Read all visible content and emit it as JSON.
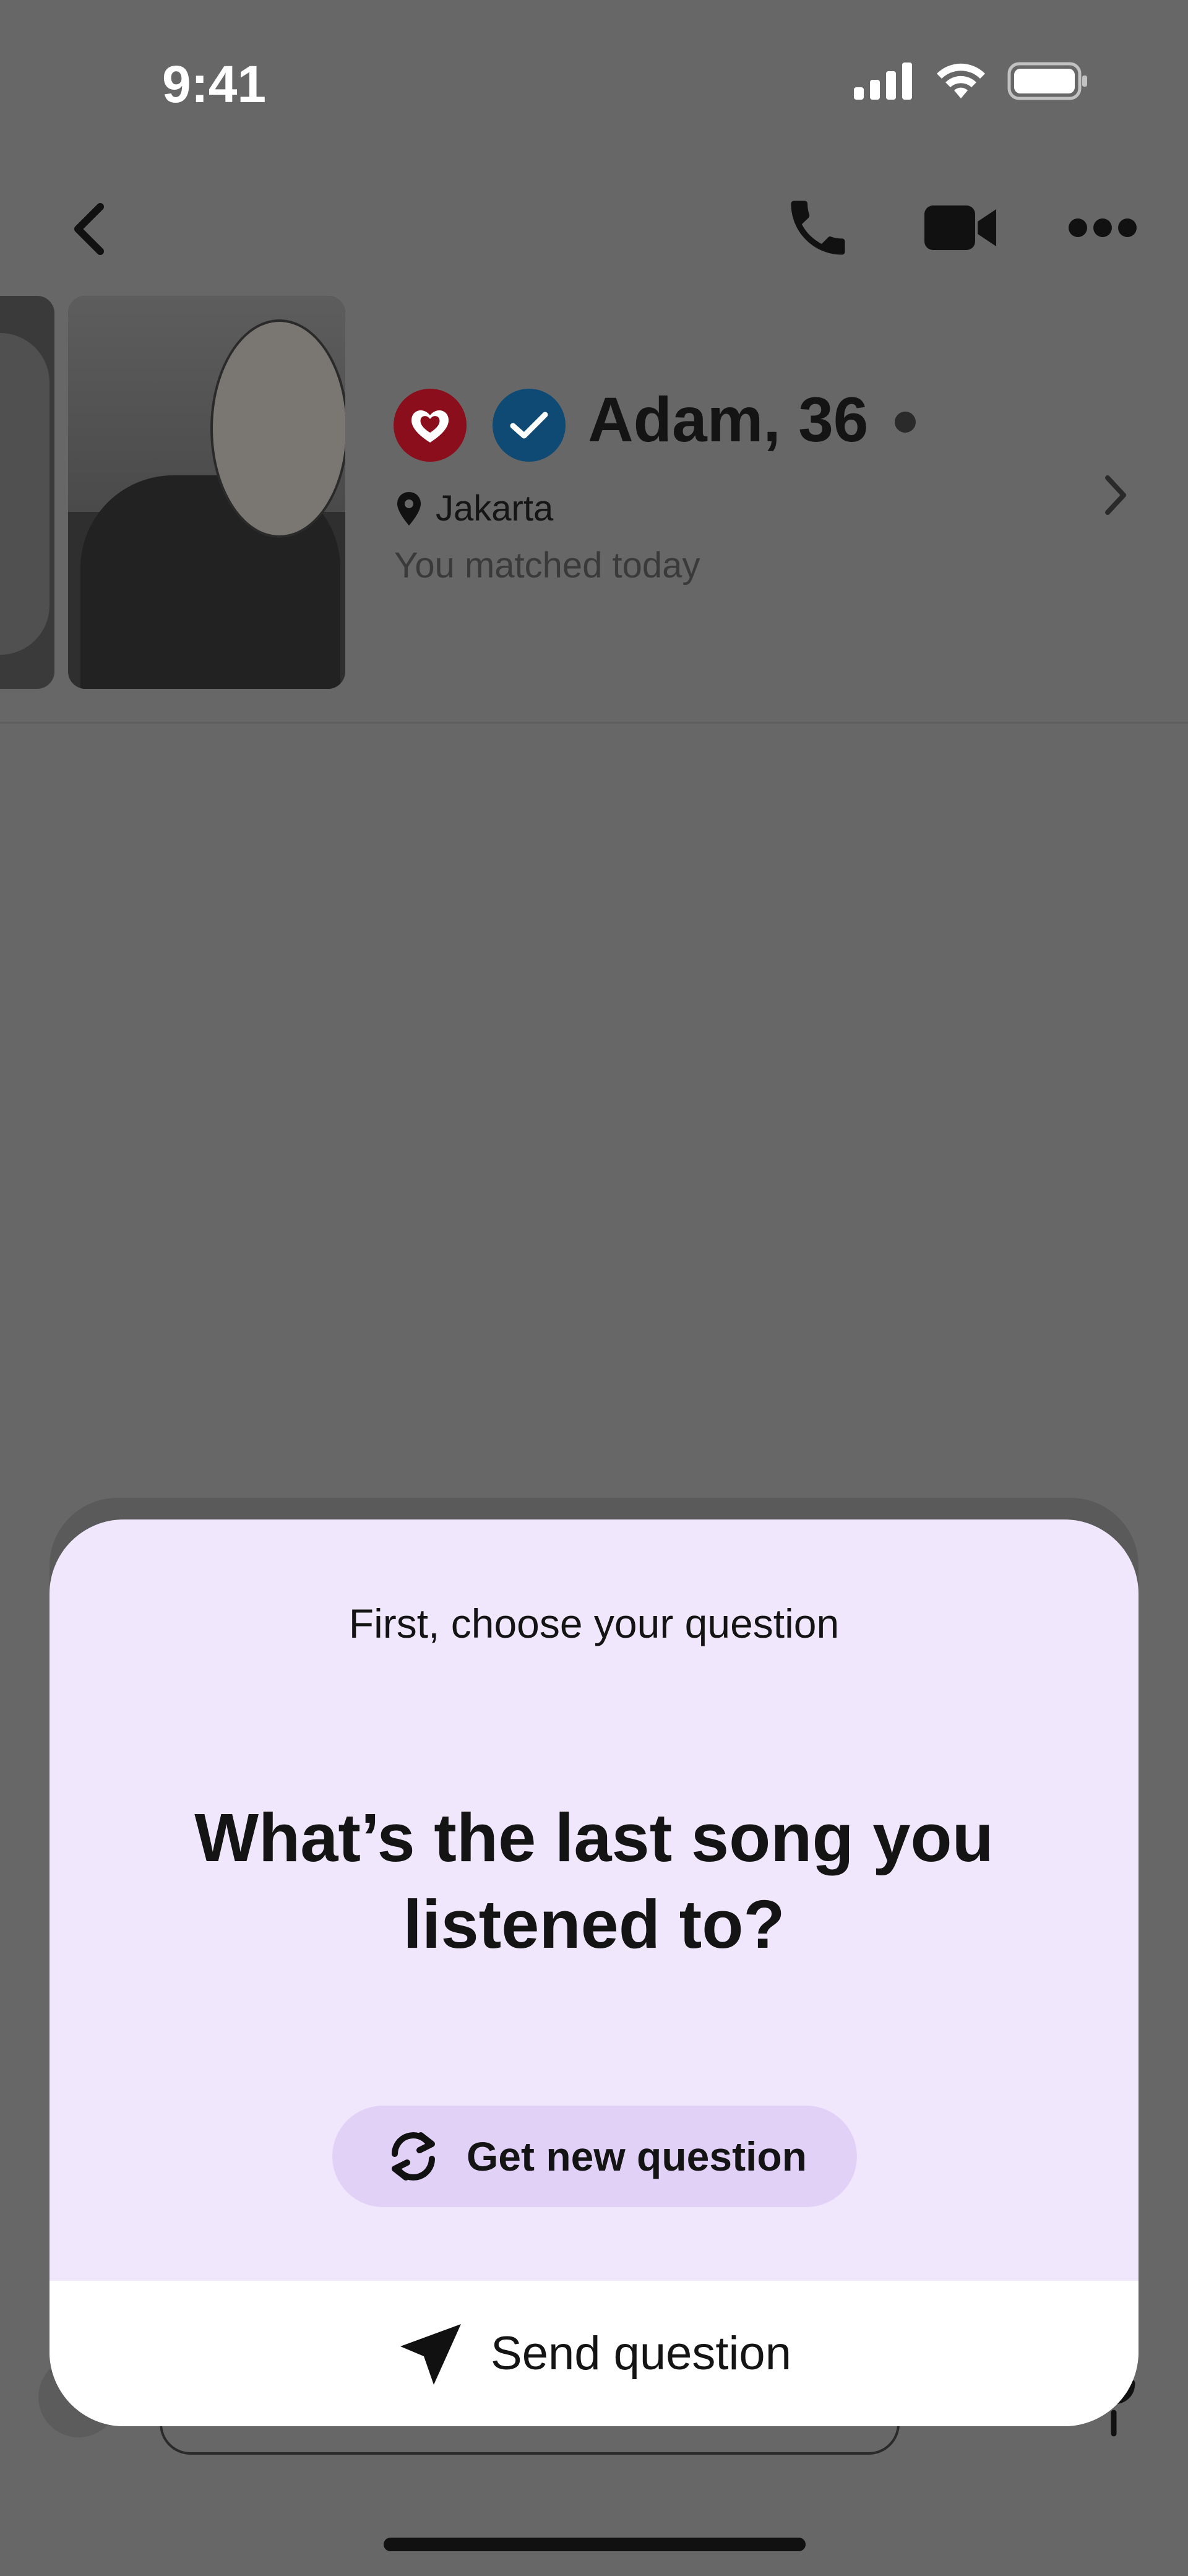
{
  "status_bar": {
    "time": "9:41"
  },
  "profile": {
    "name": "Adam, 36",
    "location": "Jakarta",
    "matched_text": "You matched today"
  },
  "question_sheet": {
    "subtitle": "First, choose your question",
    "question": "What’s the last song you listened to?",
    "new_question_label": "Get new question",
    "send_label": "Send question"
  },
  "icons": {
    "back": "chevron-left-icon",
    "call": "phone-icon",
    "video": "video-camera-icon",
    "more": "more-horizontal-icon",
    "location": "location-pin-icon",
    "refresh": "refresh-icon",
    "send": "send-arrow-icon"
  },
  "colors": {
    "overlay": "#676767",
    "sheet_background": "#f1e7fd",
    "new_question_button": "#e2d1f7",
    "heart_badge": "#8a0e1c",
    "verified_badge": "#0e4a73"
  }
}
